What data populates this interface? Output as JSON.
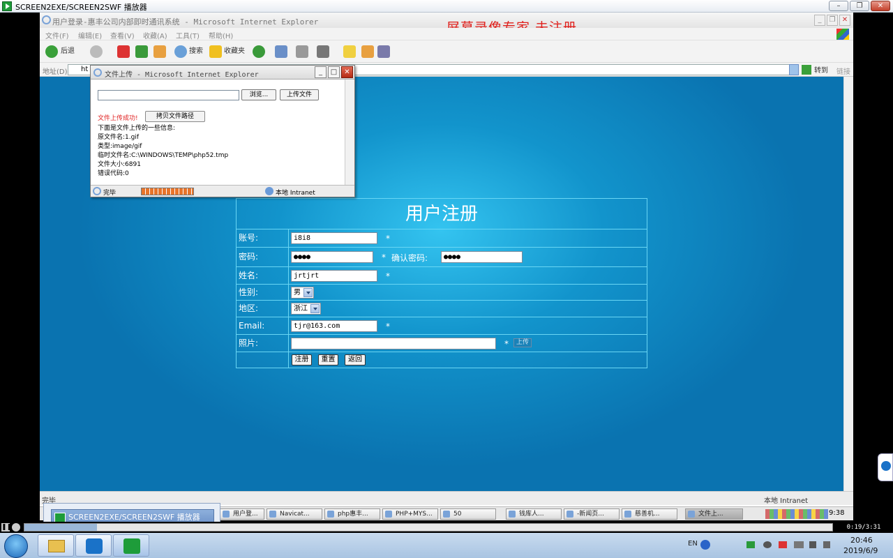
{
  "player": {
    "title": "SCREEN2EXE/SCREEN2SWF 播放器",
    "tooltip": "SCREEN2EXE/SCREEN2SWF 播放器",
    "time": "0:19/3:31",
    "progress": 0.09
  },
  "ie": {
    "title": "用户登录-惠丰公司内部即时通讯系统 - Microsoft Internet Explorer",
    "watermark": "屏幕录像专家  未注册",
    "menu": [
      "文件(F)",
      "编辑(E)",
      "查看(V)",
      "收藏(A)",
      "工具(T)",
      "帮助(H)"
    ],
    "toolbar": {
      "back": "后退",
      "search": "搜索",
      "favorites": "收藏夹"
    },
    "address_label": "地址(D)",
    "address_value": "ht",
    "go": "转到",
    "links": "链接",
    "status_left": "完毕",
    "status_right": "本地 Intranet"
  },
  "form": {
    "title": "用户注册",
    "account_label": "账号:",
    "account_value": "i8i8",
    "password_label": "密码:",
    "password_value": "●●●●",
    "confirm_label": "确认密码:",
    "confirm_value": "●●●●",
    "name_label": "姓名:",
    "name_value": "jrtjrt",
    "gender_label": "性别:",
    "gender_value": "男",
    "region_label": "地区:",
    "region_value": "浙江",
    "email_label": "Email:",
    "email_value": "tjr@163.com",
    "photo_label": "照片:",
    "photo_value": "",
    "upload_button": "上传",
    "required_mark": "*",
    "submit": "注册",
    "reset": "重置",
    "back": "返回"
  },
  "popup": {
    "title": "文件上传 - Microsoft Internet Explorer",
    "browse": "浏览...",
    "upload": "上传文件",
    "success": "文件上传成功!",
    "copy_path": "拷贝文件路径",
    "info_heading": "下面是文件上传的一些信息:",
    "original_name": "原文件名:1.gif",
    "type": "类型:image/gif",
    "temp_name": "临时文件名:C:\\WINDOWS\\TEMP\\php52.tmp",
    "size": "文件大小:6891",
    "error_code": "错误代码:0",
    "status_left": "完毕",
    "status_right": "本地 Intranet"
  },
  "ie_taskbar": [
    "用户登...",
    "Navicat...",
    "php惠丰...",
    "PHP+MYS...",
    "50",
    "钱库人...",
    "-新闻页...",
    "慈善机...",
    "文件上..."
  ],
  "ie_taskbar_clock": "9:38",
  "win_taskbar": {
    "lang": "EN",
    "time": "20:46",
    "date": "2019/6/9"
  },
  "colors": {
    "page_blue": "#1294cc",
    "form_border": "#69d6f4",
    "watermark": "#e0201c"
  }
}
